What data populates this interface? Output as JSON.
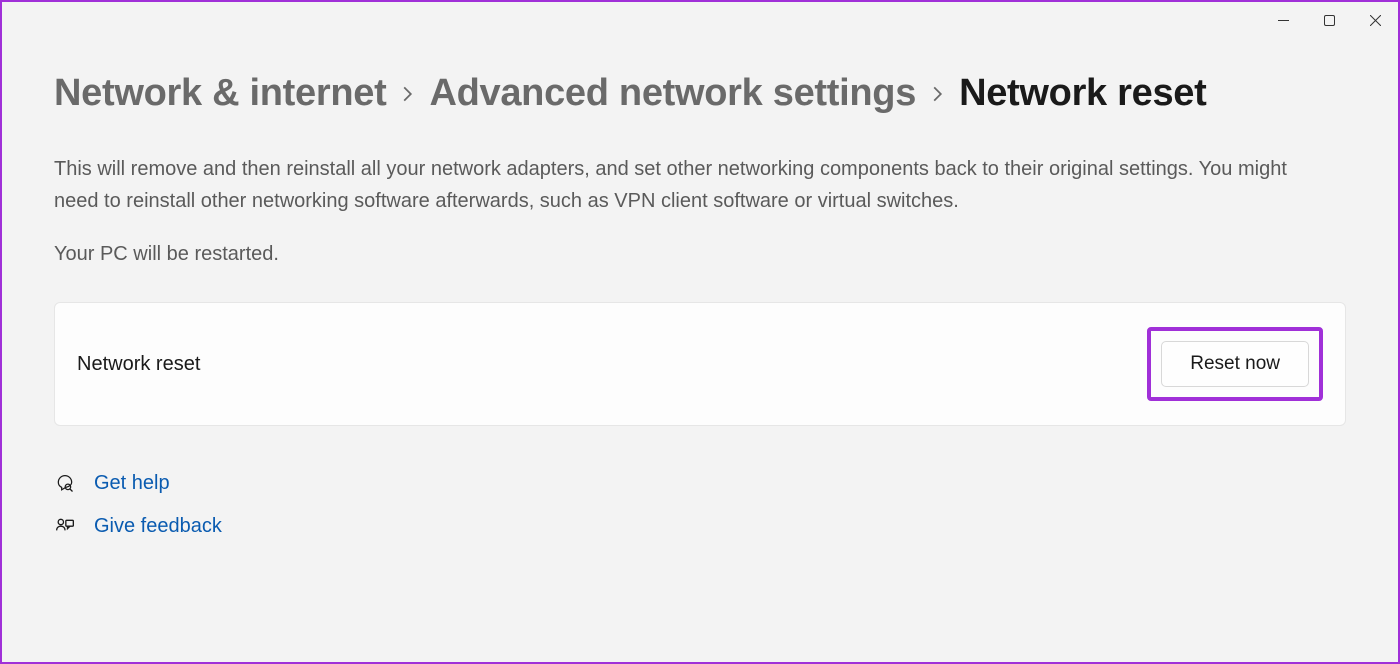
{
  "breadcrumb": {
    "items": [
      {
        "label": "Network & internet"
      },
      {
        "label": "Advanced network settings"
      },
      {
        "label": "Network reset"
      }
    ]
  },
  "description": "This will remove and then reinstall all your network adapters, and set other networking components back to their original settings. You might need to reinstall other networking software afterwards, such as VPN client software or virtual switches.",
  "restart_note": "Your PC will be restarted.",
  "card": {
    "label": "Network reset",
    "button_label": "Reset now"
  },
  "links": {
    "help": "Get help",
    "feedback": "Give feedback"
  }
}
